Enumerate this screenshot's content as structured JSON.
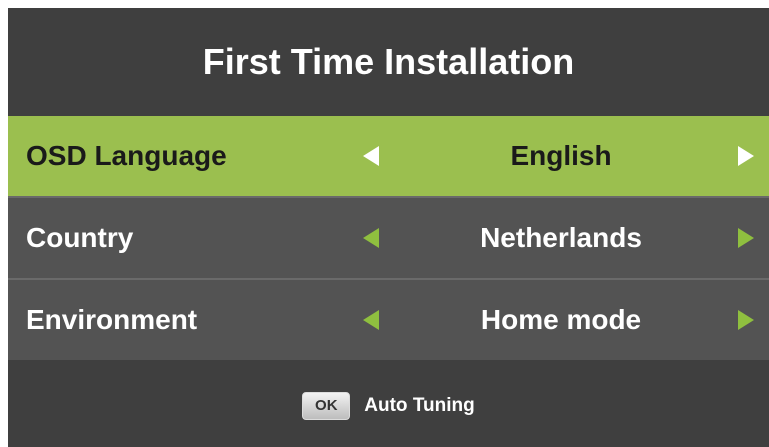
{
  "dialog": {
    "title": "First Time Installation",
    "settings": [
      {
        "label": "OSD Language",
        "value": "English",
        "selected": true
      },
      {
        "label": "Country",
        "value": "Netherlands",
        "selected": false
      },
      {
        "label": "Environment",
        "value": "Home mode",
        "selected": false
      }
    ],
    "footer": {
      "ok_key_label": "OK",
      "action_label": "Auto Tuning"
    }
  },
  "colors": {
    "panel_background": "#3f3f3f",
    "row_background": "#535353",
    "selected_row_background": "#9bbf4f",
    "arrow_accent": "#8fbf3f"
  }
}
